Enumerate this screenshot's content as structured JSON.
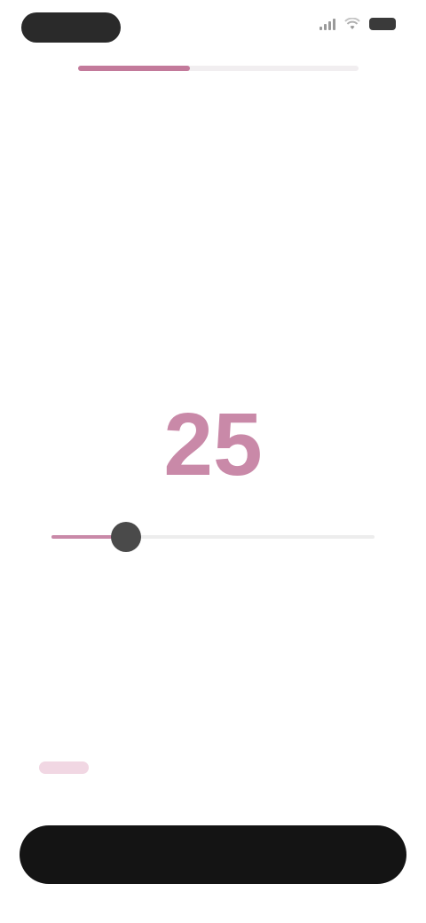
{
  "status_bar": {
    "signal_icon": "signal-icon",
    "wifi_icon": "wifi-icon",
    "battery_icon": "battery-icon"
  },
  "onboarding": {
    "progress": 0.4,
    "title": "",
    "subtitle": ""
  },
  "picker": {
    "value": "25",
    "slider_position": 0.23,
    "min_label": "",
    "max_label": "",
    "hint": ""
  },
  "footer": {
    "note": ""
  },
  "actions": {
    "continue_label": ""
  },
  "colors": {
    "accent": "#c989a8",
    "progress": "#c37a9b",
    "button": "#141414",
    "thumb": "#4a4a4a"
  }
}
